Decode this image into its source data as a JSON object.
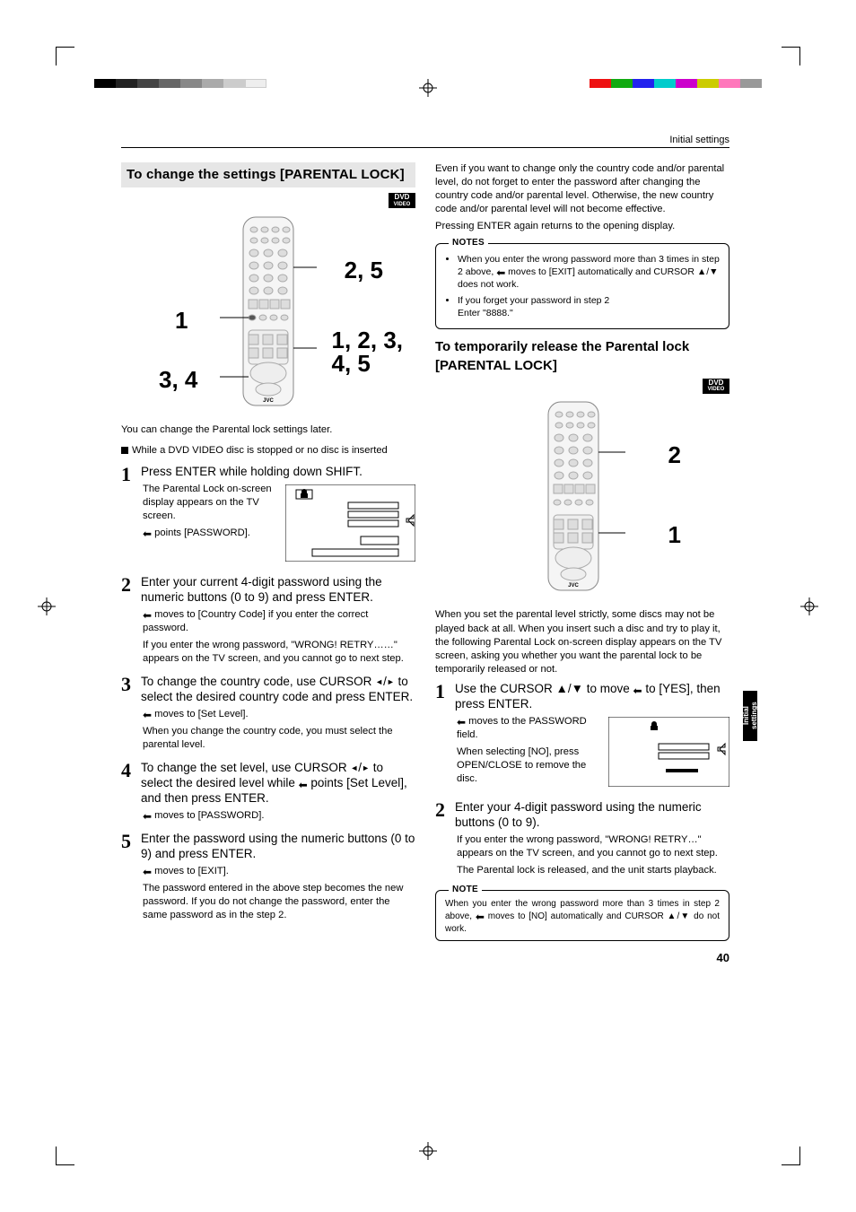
{
  "header": {
    "category": "Initial settings"
  },
  "badge": {
    "top": "DVD",
    "bottom": "VIDEO"
  },
  "sideTab": "Initial\nsettings",
  "pageNumber": "40",
  "sectionA": {
    "title": "To change the settings [PARENTAL LOCK]",
    "callouts": {
      "c1": "1",
      "c2": "2, 5",
      "c3": "1, 2, 3,\n4, 5",
      "c4": "3, 4"
    },
    "intro": "You can change the Parental lock settings later.",
    "intro2": "While a DVD VIDEO disc is stopped or no disc is inserted",
    "steps": [
      {
        "num": "1",
        "lead": "Press ENTER while holding down SHIFT.",
        "sub1": "The Parental Lock on-screen display appears on the TV screen.",
        "sub_arrow": " points [PASSWORD]."
      },
      {
        "num": "2",
        "lead": "Enter your current 4-digit password using the numeric buttons (0 to 9) and press ENTER.",
        "sub_arrow": " moves to [Country Code] if you enter the correct password.",
        "sub2": "If you enter the wrong password, \"WRONG! RETRY……\" appears on the TV screen, and you cannot go to next step."
      },
      {
        "num": "3",
        "lead_pre": "To change the country code, use CURSOR ",
        "lead_post": " to select the desired country code and press ENTER.",
        "sub_arrow": " moves to [Set Level].",
        "sub2": "When you change the country code, you must select the parental level."
      },
      {
        "num": "4",
        "lead_pre": "To change the set level, use CURSOR ",
        "lead_mid": " to select the desired level while ",
        "lead_post": " points [Set Level], and then press ENTER.",
        "sub_arrow": " moves to [PASSWORD]."
      },
      {
        "num": "5",
        "lead": "Enter the password using the numeric buttons (0 to 9) and press ENTER.",
        "sub_arrow": " moves to [EXIT].",
        "sub2": "The password entered in the above step becomes the new password. If you do not change the password, enter the same password as in the step 2."
      }
    ]
  },
  "sectionB": {
    "topText": "Even if you want to change only the country code and/or parental level, do not forget to enter the password after changing the country code and/or parental level. Otherwise, the new country code and/or parental level will not become effective.",
    "topText2": "Pressing ENTER again returns to the opening display.",
    "notesLabel": "NOTES",
    "note1_pre": "When you enter the wrong password more than 3 times in step 2 above, ",
    "note1_post": " moves to [EXIT] automatically and CURSOR ▲/▼ does not work.",
    "note2": "If you forget your password in step 2",
    "note2b": "Enter \"8888.\"",
    "title": "To temporarily release the Parental lock [PARENTAL LOCK]",
    "callouts": {
      "c1": "1",
      "c2": "2"
    },
    "intro": "When you set the parental level strictly, some discs may not be played back at all. When you insert such a disc and try to play it, the following Parental Lock on-screen display appears on the TV screen, asking you whether you want the parental lock to be temporarily released or not.",
    "steps": [
      {
        "num": "1",
        "lead_pre": "Use the CURSOR ▲/▼ to move ",
        "lead_post": " to [YES], then press ENTER.",
        "sub_arrow": " moves to the PASSWORD field.",
        "sub2": "When selecting [NO], press OPEN/CLOSE to remove the disc."
      },
      {
        "num": "2",
        "lead": "Enter your 4-digit password using the numeric buttons (0 to 9).",
        "sub1": "If you enter the wrong password, \"WRONG! RETRY…\" appears on the TV screen, and you cannot go to next step.",
        "sub2": "The Parental lock is released, and the unit starts playback."
      }
    ],
    "noteLabel2": "NOTE",
    "note3_pre": "When you enter the wrong password more than 3 times in step 2 above, ",
    "note3_post": " moves to [NO] automatically and CURSOR ▲/▼ do not work."
  }
}
